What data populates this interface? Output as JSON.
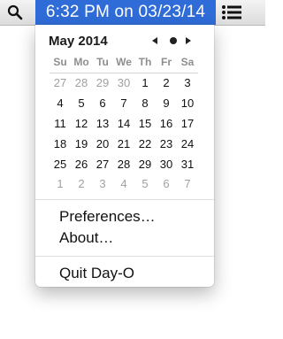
{
  "menubar": {
    "clock": "6:32 PM on 03/23/14",
    "icons": {
      "search": "search-icon",
      "menu": "list-icon"
    }
  },
  "calendar": {
    "month_title": "May 2014",
    "nav": {
      "prev": "◀",
      "today": "●",
      "next": "▶"
    },
    "weekdays": [
      "Su",
      "Mo",
      "Tu",
      "We",
      "Th",
      "Fr",
      "Sa"
    ],
    "weeks": [
      [
        "27",
        "28",
        "29",
        "30",
        "1",
        "2",
        "3"
      ],
      [
        "4",
        "5",
        "6",
        "7",
        "8",
        "9",
        "10"
      ],
      [
        "11",
        "12",
        "13",
        "14",
        "15",
        "16",
        "17"
      ],
      [
        "18",
        "19",
        "20",
        "21",
        "22",
        "23",
        "24"
      ],
      [
        "25",
        "26",
        "27",
        "28",
        "29",
        "30",
        "31"
      ],
      [
        "1",
        "2",
        "3",
        "4",
        "5",
        "6",
        "7"
      ]
    ],
    "outside_days": [
      [
        true,
        true,
        true,
        true,
        false,
        false,
        false
      ],
      [
        false,
        false,
        false,
        false,
        false,
        false,
        false
      ],
      [
        false,
        false,
        false,
        false,
        false,
        false,
        false
      ],
      [
        false,
        false,
        false,
        false,
        false,
        false,
        false
      ],
      [
        false,
        false,
        false,
        false,
        false,
        false,
        false
      ],
      [
        true,
        true,
        true,
        true,
        true,
        true,
        true
      ]
    ]
  },
  "menu": {
    "preferences": "Preferences…",
    "about": "About…",
    "quit": "Quit Day-O"
  },
  "colors": {
    "highlight": "#2f6cd8",
    "outside_day": "#a0a0a0",
    "weekday_header": "#8e8e8e"
  }
}
